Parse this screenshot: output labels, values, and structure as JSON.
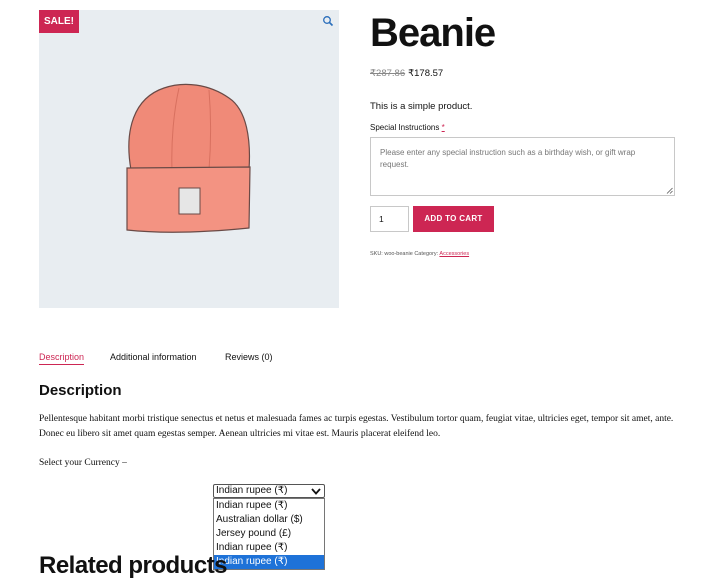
{
  "product": {
    "sale_badge": "SALE!",
    "title": "Beanie",
    "price_old": "₹287.86",
    "price_new": "₹178.57",
    "short_description": "This is a simple product.",
    "special_instructions_label": "Special Instructions",
    "required_mark": "*",
    "special_instructions_placeholder": "Please enter any special instruction such as a birthday wish, or gift wrap request.",
    "quantity": "1",
    "add_to_cart_label": "ADD TO CART",
    "sku_text": "SKU: woo-beanie Category:",
    "category_link": "Accessories",
    "image_colors": {
      "background": "#e8edf1",
      "beanie": "#f08a78",
      "label": "#e6e6e6"
    }
  },
  "tabs": [
    "Description",
    "Additional information",
    "Reviews (0)"
  ],
  "description": {
    "heading": "Description",
    "body": "Pellentesque habitant morbi tristique senectus et netus et malesuada fames ac turpis egestas. Vestibulum tortor quam, feugiat vitae, ultricies eget, tempor sit amet, ante. Donec eu libero sit amet quam egestas semper. Aenean ultricies mi vitae est. Mauris placerat eleifend leo.",
    "currency_label": "Select your Currency –"
  },
  "currency_select": {
    "selected": "Indian rupee (₹)",
    "options": [
      "Indian rupee (₹)",
      "Australian dollar ($)",
      "Jersey pound (£)",
      "Indian rupee (₹)",
      "Indian rupee (₹)"
    ],
    "highlighted_index": 4
  },
  "related": {
    "heading": "Related products"
  },
  "colors": {
    "accent": "#cd2653",
    "highlight": "#1e72d8"
  }
}
